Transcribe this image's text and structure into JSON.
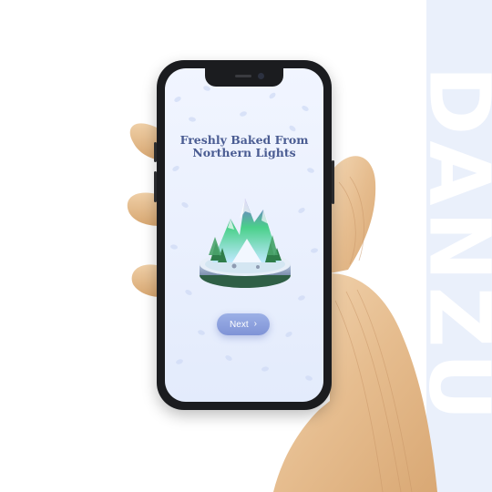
{
  "brand": {
    "word": "DANZU"
  },
  "onboarding": {
    "title_line1": "Freshly Baked From",
    "title_line2": "Northern Lights",
    "illustration": "aurora-mountain-island",
    "next_label": "Next",
    "next_icon": "chevron-right-icon"
  },
  "colors": {
    "title": "#4a5c92",
    "button": "#8fa3df",
    "screen_bg": "#eaf0fd",
    "brand_strip": "#eaf0fb",
    "phone_frame": "#1b1c1f"
  }
}
